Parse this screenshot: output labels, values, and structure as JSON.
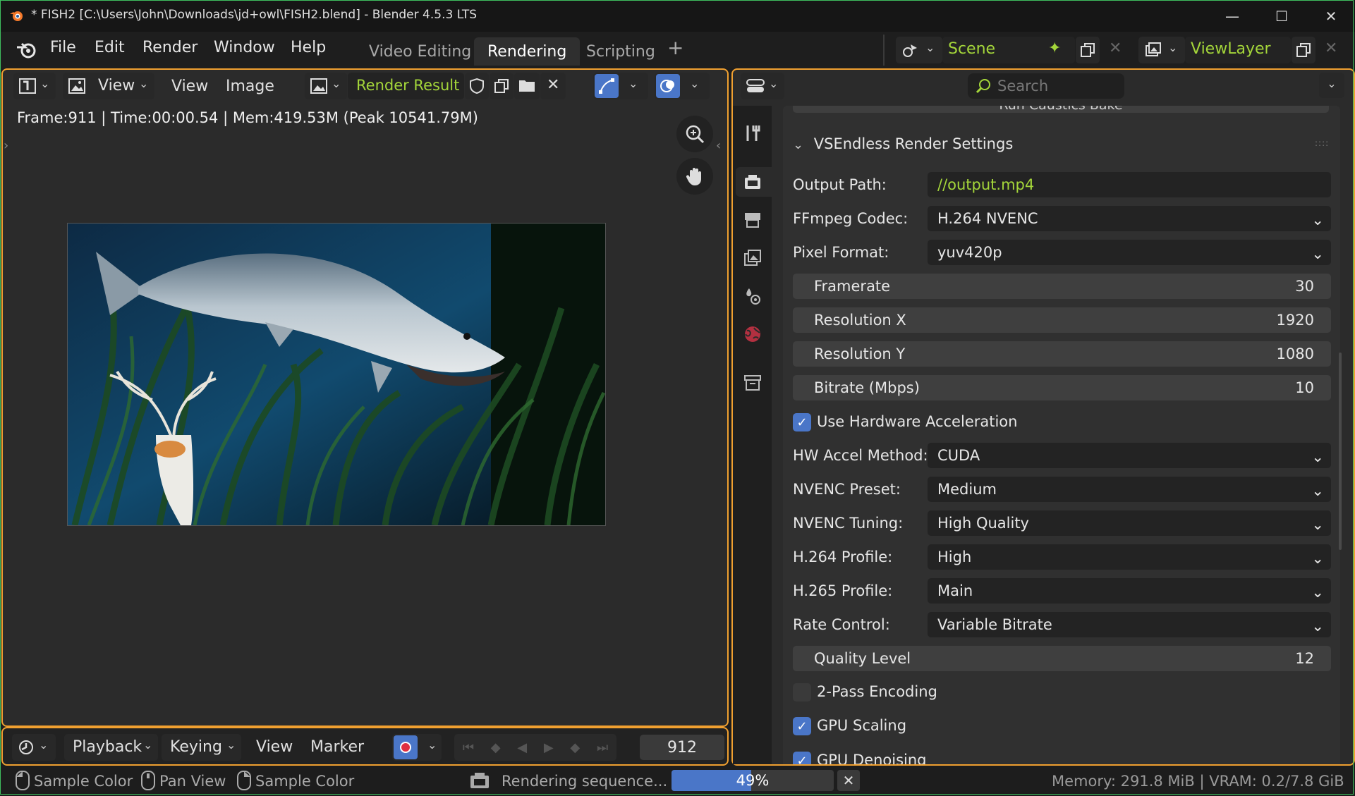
{
  "window": {
    "title": "* FISH2 [C:\\Users\\John\\Downloads\\jd+owl\\FISH2.blend] - Blender 4.5.3 LTS",
    "accent_color": "#f0a030",
    "active_color": "#4a76c8"
  },
  "menubar": {
    "items": [
      "File",
      "Edit",
      "Render",
      "Window",
      "Help"
    ],
    "workspace_tabs": [
      "Video Editing",
      "Rendering",
      "Scripting"
    ],
    "active_workspace": "Rendering",
    "scene": "Scene",
    "view_layer": "ViewLayer"
  },
  "image_editor": {
    "view_menu": "View",
    "menus": [
      "View",
      "Image"
    ],
    "image_name": "Render Result",
    "frame_info": "Frame:911 | Time:00:00.54 | Mem:419.53M (Peak 10541.79M)"
  },
  "timeline": {
    "menus": [
      "Playback",
      "Keying",
      "View",
      "Marker"
    ],
    "current_frame": "912"
  },
  "properties": {
    "search_placeholder": "Search",
    "cut_off_button": "Run Caustics Bake",
    "panel_title": "VSEndless Render Settings",
    "output_path_label": "Output Path:",
    "output_path": "//output.mp4",
    "ffmpeg_codec_label": "FFmpeg Codec:",
    "ffmpeg_codec": "H.264 NVENC",
    "pixel_format_label": "Pixel Format:",
    "pixel_format": "yuv420p",
    "framerate_label": "Framerate",
    "framerate": "30",
    "res_x_label": "Resolution X",
    "res_x": "1920",
    "res_y_label": "Resolution Y",
    "res_y": "1080",
    "bitrate_label": "Bitrate (Mbps)",
    "bitrate": "10",
    "hw_accel_label": "Use Hardware Acceleration",
    "hw_accel": true,
    "hw_method_label": "HW Accel Method:",
    "hw_method": "CUDA",
    "nvenc_preset_label": "NVENC Preset:",
    "nvenc_preset": "Medium",
    "nvenc_tuning_label": "NVENC Tuning:",
    "nvenc_tuning": "High Quality",
    "h264_profile_label": "H.264 Profile:",
    "h264_profile": "High",
    "h265_profile_label": "H.265 Profile:",
    "h265_profile": "Main",
    "rate_control_label": "Rate Control:",
    "rate_control": "Variable Bitrate",
    "quality_label": "Quality Level",
    "quality": "12",
    "two_pass_label": "2-Pass Encoding",
    "two_pass": false,
    "gpu_scaling_label": "GPU Scaling",
    "gpu_scaling": true,
    "gpu_denoising_label": "GPU Denoising",
    "gpu_denoising": true
  },
  "statusbar": {
    "hints": [
      "Sample Color",
      "Pan View",
      "Sample Color"
    ],
    "job_text": "Rendering sequence...",
    "progress_label": "49%",
    "progress": 0.49,
    "memory": "Memory: 291.8 MiB | VRAM: 0.2/7.8 GiB"
  }
}
